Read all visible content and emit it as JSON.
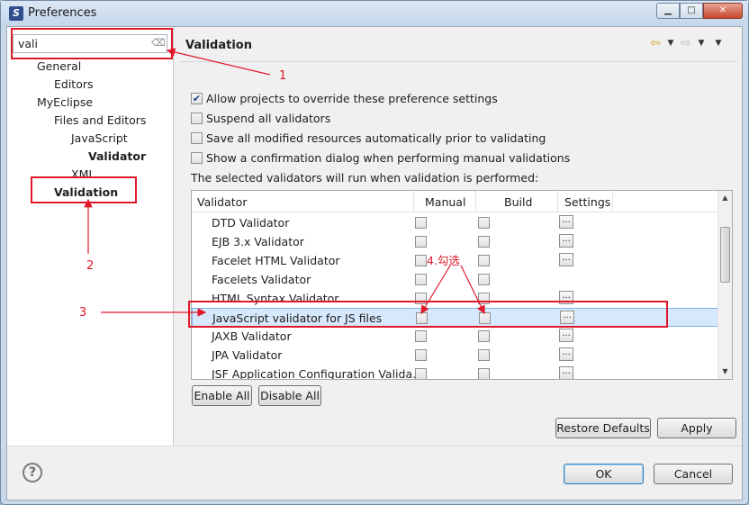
{
  "window": {
    "title": "Preferences",
    "minimize_label": "▁",
    "maximize_label": "□",
    "close_label": "✕"
  },
  "sidebar": {
    "filter_value": "vali",
    "items": [
      {
        "label": "General",
        "level": 1,
        "bold": false
      },
      {
        "label": "Editors",
        "level": 2,
        "bold": false
      },
      {
        "label": "MyEclipse",
        "level": 1,
        "bold": false
      },
      {
        "label": "Files and Editors",
        "level": 2,
        "bold": false
      },
      {
        "label": "JavaScript",
        "level": 3,
        "bold": false
      },
      {
        "label": "Validator",
        "level": 4,
        "bold": true
      },
      {
        "label": "XML",
        "level": 3,
        "bold": false
      },
      {
        "label": "Validation",
        "level": 2,
        "bold": true
      }
    ]
  },
  "page": {
    "title": "Validation",
    "options": [
      {
        "label": "Allow projects to override these preference settings",
        "checked": true
      },
      {
        "label": "Suspend all validators",
        "checked": false
      },
      {
        "label": "Save all modified resources automatically prior to validating",
        "checked": false
      },
      {
        "label": "Show a confirmation dialog when performing manual validations",
        "checked": false
      }
    ],
    "info": "The selected validators will run when validation is performed:"
  },
  "table": {
    "headers": {
      "validator": "Validator",
      "manual": "Manual",
      "build": "Build",
      "settings": "Settings"
    },
    "settings_button_label": "...",
    "rows": [
      {
        "name": "DTD Validator",
        "settings": true
      },
      {
        "name": "EJB 3.x Validator",
        "settings": true
      },
      {
        "name": "Facelet HTML Validator",
        "settings": true
      },
      {
        "name": "Facelets Validator",
        "settings": false
      },
      {
        "name": "HTML Syntax Validator",
        "settings": true
      },
      {
        "name": "JavaScript validator for JS files",
        "settings": true,
        "selected": true
      },
      {
        "name": "JAXB Validator",
        "settings": true
      },
      {
        "name": "JPA Validator",
        "settings": true
      },
      {
        "name": "JSF Application Configuration Valida...",
        "settings": true
      }
    ]
  },
  "buttons": {
    "enable_all": "Enable All",
    "disable_all": "Disable All",
    "restore_defaults": "Restore Defaults",
    "apply": "Apply",
    "ok": "OK",
    "cancel": "Cancel"
  },
  "annotations": {
    "n1": "1",
    "n2": "2",
    "n3": "3",
    "n4": "4.勾选",
    "color": "#e0192a"
  }
}
